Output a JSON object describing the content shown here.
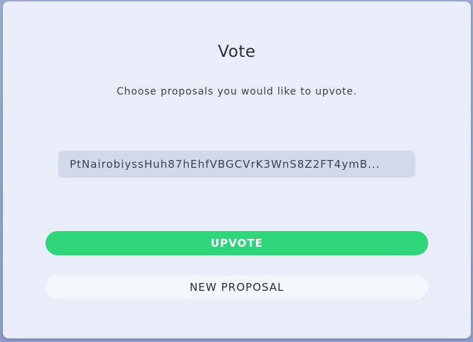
{
  "modal": {
    "title": "Vote",
    "subtitle": "Choose proposals you would like to upvote."
  },
  "proposals": [
    {
      "hash": "PtNairobiyssHuh87hEhfVBGCVrK3WnS8Z2FT4ymB..."
    }
  ],
  "actions": {
    "upvote_label": "UPVOTE",
    "new_proposal_label": "NEW PROPOSAL"
  },
  "colors": {
    "upvote_button": "#2ed67a",
    "modal_background": "#e9edf8",
    "proposal_item_background": "#d2d9ea"
  }
}
